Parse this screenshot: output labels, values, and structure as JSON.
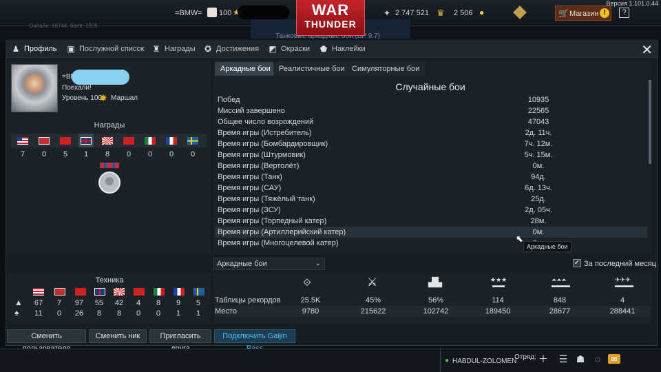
{
  "top": {
    "version": "Версия 1.101.0.44",
    "online": "Онлайн: 66744, боев: 1906",
    "nick": "=BMW=",
    "premium": "100",
    "silver": "2 747 521",
    "gold": "2 506",
    "shop": "Магазин",
    "help": "?",
    "logo1": "WAR",
    "logo2": "THUNDER",
    "bg_text": "Танковые аркадные бои (БР 9.7)"
  },
  "tabs": [
    {
      "label": "Профиль",
      "icon": "profile-icon"
    },
    {
      "label": "Послужной список",
      "icon": "service-record-icon"
    },
    {
      "label": "Награды",
      "icon": "trophy-icon"
    },
    {
      "label": "Достижения",
      "icon": "star-icon"
    },
    {
      "label": "Окраски",
      "icon": "camouflage-icon"
    },
    {
      "label": "Наклейки",
      "icon": "decal-icon"
    }
  ],
  "profile": {
    "nick": "=BMW=",
    "title": "Поехали!",
    "level": "Уровень 100",
    "rank": "Маршал"
  },
  "awards": {
    "header": "Награды",
    "counts": [
      "7",
      "0",
      "5",
      "1",
      "8",
      "0",
      "0",
      "0",
      "0"
    ]
  },
  "vehicles": {
    "header": "Техника",
    "row1": [
      "67",
      "7",
      "97",
      "55",
      "42",
      "4",
      "8",
      "9",
      "5"
    ],
    "row2": [
      "11",
      "0",
      "26",
      "8",
      "8",
      "0",
      "0",
      "1",
      "1"
    ]
  },
  "mode_tabs": [
    "Аркадные бои",
    "Реалистичные бои",
    "Симуляторные бои"
  ],
  "stats": {
    "title": "Случайные бои",
    "rows": [
      {
        "k": "Побед",
        "v": "10935"
      },
      {
        "k": "Миссий завершено",
        "v": "22565"
      },
      {
        "k": "Общее число возрождений",
        "v": "47043"
      },
      {
        "k": "Время игры (Истребитель)",
        "v": "2д. 11ч."
      },
      {
        "k": "Время игры (Бомбардировщик)",
        "v": "7ч. 12м."
      },
      {
        "k": "Время игры (Штурмовик)",
        "v": "5ч. 15м."
      },
      {
        "k": "Время игры (Вертолёт)",
        "v": "0м."
      },
      {
        "k": "Время игры (Танк)",
        "v": "94д."
      },
      {
        "k": "Время игры (САУ)",
        "v": "6д. 13ч."
      },
      {
        "k": "Время игры (Тяжёлый танк)",
        "v": "25д."
      },
      {
        "k": "Время игры (ЗСУ)",
        "v": "2д. 05ч."
      },
      {
        "k": "Время игры (Торпедный катер)",
        "v": "28м."
      },
      {
        "k": "Время игры (Артиллерийский катер)",
        "v": "0м."
      },
      {
        "k": "Время игры (Многоцелевой катер)",
        "v": "0м."
      }
    ]
  },
  "tooltip": "Аркадные бои",
  "filter": {
    "select": "Аркадные бои",
    "checkbox": "За последний месяц"
  },
  "ranking": {
    "label1": "Таблицы рекордов",
    "label2": "Место",
    "row1": [
      "25.5K",
      "45%",
      "56%",
      "114",
      "848",
      "4"
    ],
    "row2": [
      "9780",
      "215622",
      "102742",
      "189450",
      "28677",
      "288441"
    ]
  },
  "buttons": {
    "switch_user": "Сменить пользователя",
    "change_nick": "Сменить ник",
    "invite": "Пригласить друга",
    "gaijin": "Подключить Gaijin Pass"
  },
  "bottom": {
    "user": "HABDUL-ZOLOMEN",
    "squad": "Отряд:"
  }
}
